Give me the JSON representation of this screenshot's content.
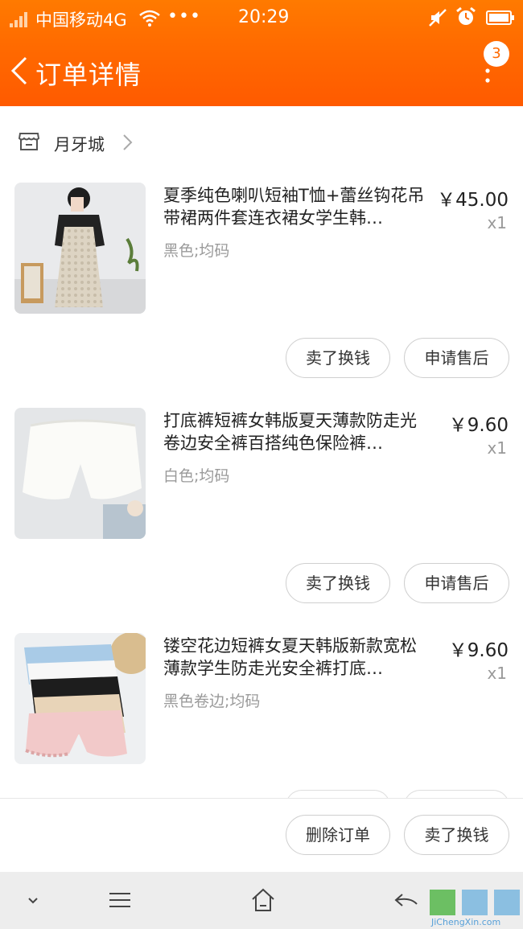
{
  "status_bar": {
    "carrier": "中国移动4G",
    "dots": "•••",
    "time": "20:29"
  },
  "header": {
    "title": "订单详情",
    "badge_count": "3"
  },
  "shop": {
    "name": "月牙城"
  },
  "items": [
    {
      "title": "夏季纯色喇叭短袖T恤+蕾丝钩花吊带裙两件套连衣裙女学生韩…",
      "spec": "黑色;均码",
      "price": "￥45.00",
      "qty": "x1",
      "btn_left": "卖了换钱",
      "btn_right": "申请售后"
    },
    {
      "title": "打底裤短裤女韩版夏天薄款防走光卷边安全裤百搭纯色保险裤…",
      "spec": "白色;均码",
      "price": "￥9.60",
      "qty": "x1",
      "btn_left": "卖了换钱",
      "btn_right": "申请售后"
    },
    {
      "title": "镂空花边短裤女夏天韩版新款宽松薄款学生防走光安全裤打底…",
      "spec": "黑色卷边;均码",
      "price": "￥9.60",
      "qty": "x1"
    }
  ],
  "action_bar": {
    "delete_label": "删除订单",
    "sell_label": "卖了换钱"
  },
  "watermark": {
    "text": "JiChengXin.com"
  },
  "colors": {
    "header": "#ff6a00",
    "nav_bar": "#ededed"
  }
}
